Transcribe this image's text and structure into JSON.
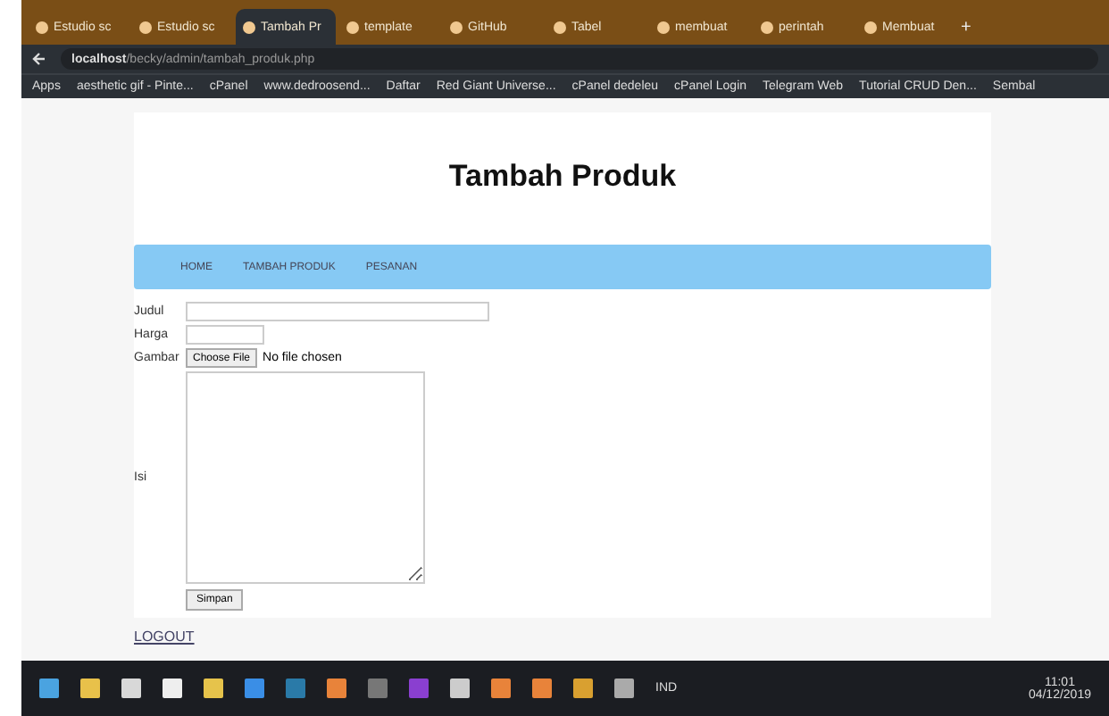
{
  "browser": {
    "tabs": [
      {
        "label": "Estudio sc",
        "selected": false
      },
      {
        "label": "Estudio sc",
        "selected": false
      },
      {
        "label": "Tambah Pr",
        "selected": true
      },
      {
        "label": "template",
        "selected": false
      },
      {
        "label": "GitHub",
        "selected": false
      },
      {
        "label": "Tabel",
        "selected": false
      },
      {
        "label": "membuat",
        "selected": false
      },
      {
        "label": "perintah",
        "selected": false
      },
      {
        "label": "Membuat",
        "selected": false
      }
    ],
    "new_tab": "+",
    "url_host": "localhost",
    "url_path": "/becky/admin/tambah_produk.php",
    "bookmarks": [
      "Apps",
      "aesthetic gif - Pinte...",
      "cPanel",
      "www.dedroosend...",
      "Daftar",
      "Red Giant Universe...",
      "cPanel dedeleu",
      "cPanel Login",
      "Telegram Web",
      "Tutorial CRUD Den...",
      "Sembal"
    ]
  },
  "page": {
    "title": "Tambah Produk",
    "nav": [
      "HOME",
      "TAMBAH PRODUK",
      "PESANAN"
    ],
    "form": [
      {
        "kind": "text",
        "label": "Judul"
      },
      {
        "kind": "short",
        "label": "Harga"
      },
      {
        "kind": "file",
        "label": "Gambar",
        "button": "Choose File",
        "status": "No file chosen"
      },
      {
        "kind": "textarea",
        "label": "Isi"
      }
    ],
    "submit": "Simpan",
    "logout": "LOGOUT"
  },
  "taskbar": {
    "time": "11:01",
    "date": "04/12/2019",
    "lang": "IND"
  }
}
